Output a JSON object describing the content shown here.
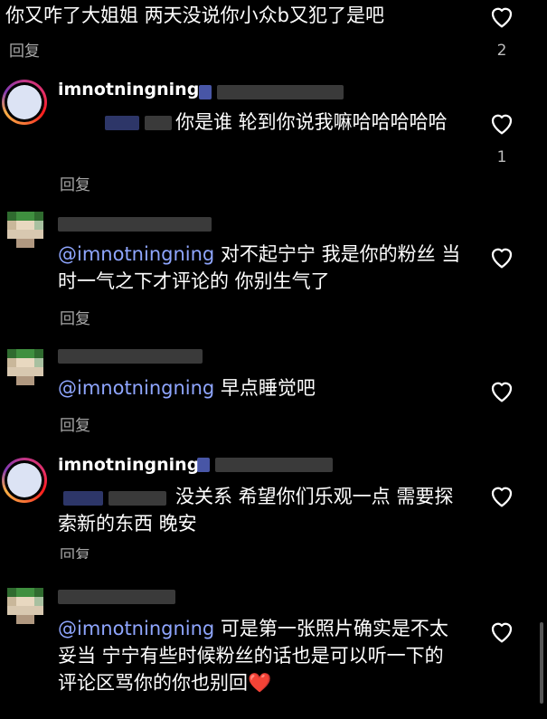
{
  "comments": [
    {
      "text": "你又咋了大姐姐 两天没说你小众b又犯了是吧",
      "reply": "回复",
      "likes": "2"
    },
    {
      "username": "imnotningning",
      "text": "你是谁 轮到你说我嘛哈哈哈哈哈",
      "reply": "回复",
      "likes": "1"
    },
    {
      "mention": "@imnotningning",
      "text": " 对不起宁宁 我是你的粉丝 当时一气之下才评论的 你别生气了",
      "reply": "回复"
    },
    {
      "mention": "@imnotningning",
      "text": " 早点睡觉吧",
      "reply": "回复"
    },
    {
      "username": "imnotningning",
      "text": "没关系 希望你们乐观一点 需要探索新的东西 晚安",
      "reply": "回复"
    },
    {
      "mention": "@imnotningning",
      "text": " 可是第一张照片确实是不太妥当 宁宁有些时候粉丝的话也是可以听一下的 评论区骂你的你也别回",
      "emoji": "❤️"
    }
  ],
  "icons": {
    "like": "heart-outline-icon",
    "emoji": "red-heart-emoji"
  },
  "colors": {
    "mention": "#8fa6ff",
    "secondary_text": "#a8a8a8"
  }
}
